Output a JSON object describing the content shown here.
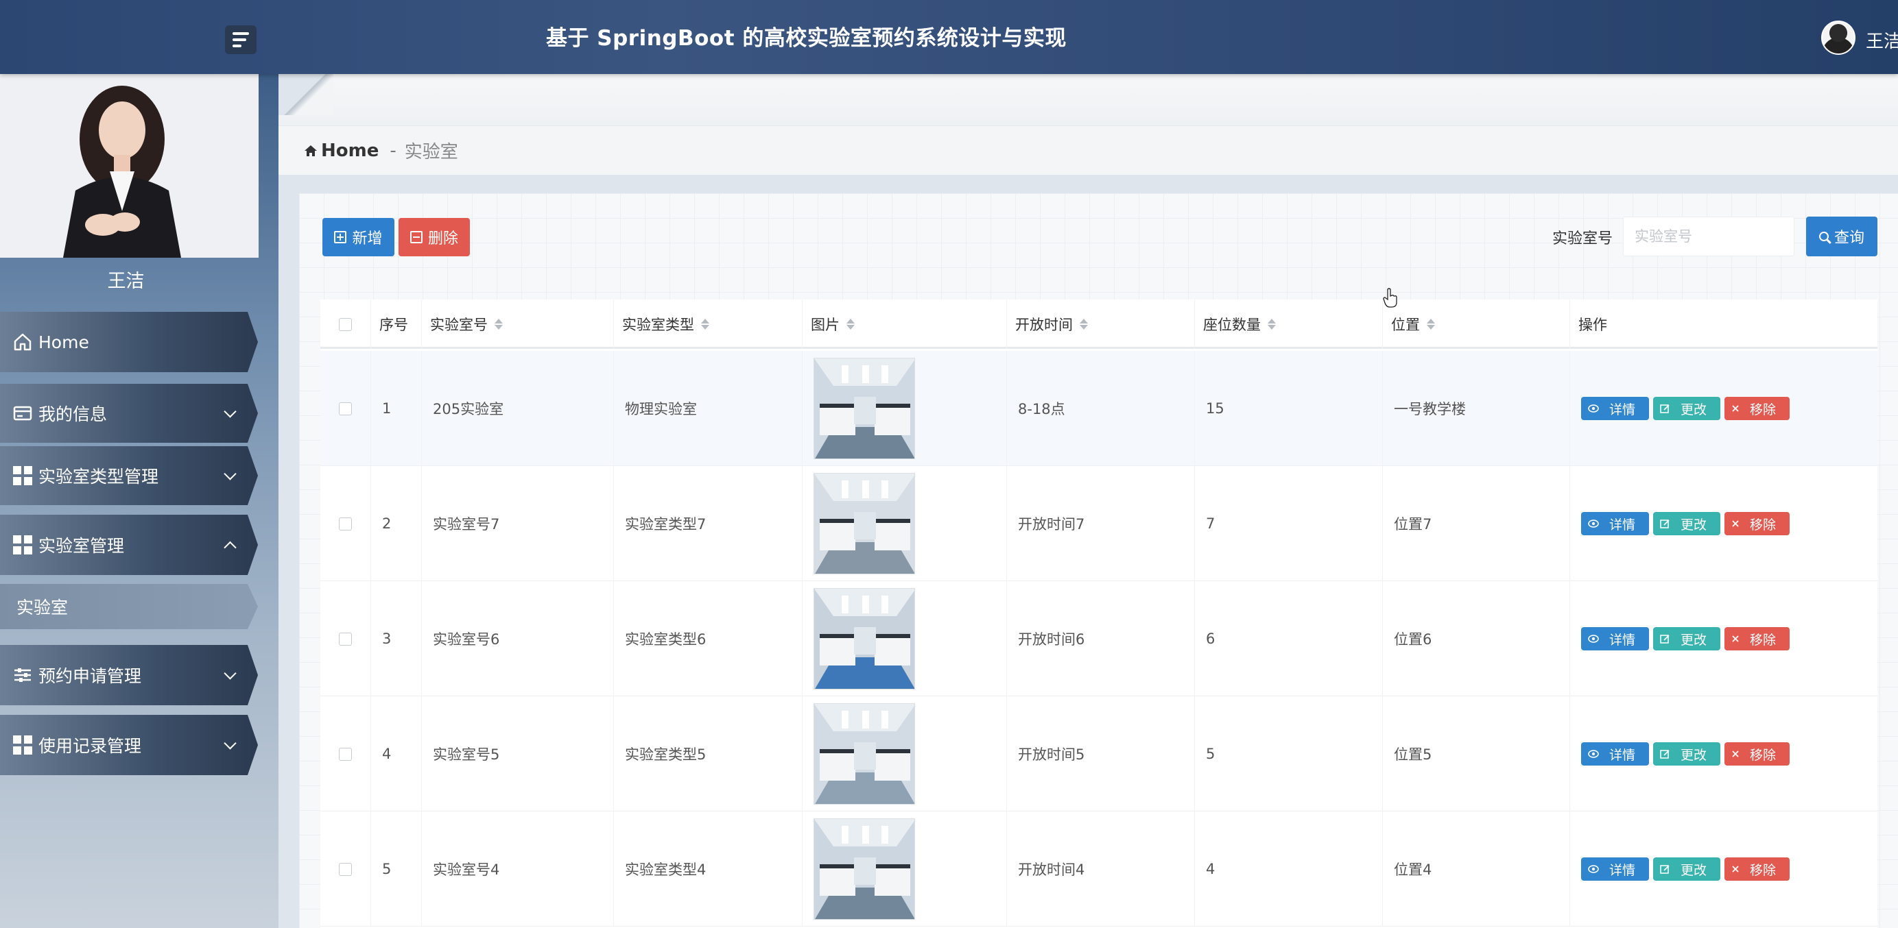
{
  "header": {
    "title": "基于 SpringBoot 的高校实验室预约系统设计与实现",
    "user_name": "王洁"
  },
  "sidebar": {
    "profile_name": "王洁",
    "items": [
      {
        "label": "Home",
        "icon": "home-icon"
      },
      {
        "label": "我的信息",
        "icon": "card-icon"
      },
      {
        "label": "实验室类型管理",
        "icon": "grid-icon"
      },
      {
        "label": "实验室管理",
        "icon": "grid-icon"
      },
      {
        "label": "实验室",
        "icon": ""
      },
      {
        "label": "预约申请管理",
        "icon": "sliders-icon"
      },
      {
        "label": "使用记录管理",
        "icon": "grid-icon"
      }
    ]
  },
  "breadcrumb": {
    "home": "Home",
    "separator": "-",
    "current": "实验室"
  },
  "toolbar": {
    "add_label": "新增",
    "delete_label": "删除",
    "search_label": "实验室号",
    "search_placeholder": "实验室号",
    "search_value": "",
    "search_button": "查询"
  },
  "table": {
    "headers": [
      "序号",
      "实验室号",
      "实验室类型",
      "图片",
      "开放时间",
      "座位数量",
      "位置",
      "操作"
    ],
    "actions": {
      "detail": "详情",
      "edit": "更改",
      "remove": "移除"
    },
    "rows": [
      {
        "index": "1",
        "room": "205实验室",
        "type": "物理实验室",
        "open": "8-18点",
        "seats": "15",
        "location": "一号教学楼"
      },
      {
        "index": "2",
        "room": "实验室号7",
        "type": "实验室类型7",
        "open": "开放时间7",
        "seats": "7",
        "location": "位置7"
      },
      {
        "index": "3",
        "room": "实验室号6",
        "type": "实验室类型6",
        "open": "开放时间6",
        "seats": "6",
        "location": "位置6"
      },
      {
        "index": "4",
        "room": "实验室号5",
        "type": "实验室类型5",
        "open": "开放时间5",
        "seats": "5",
        "location": "位置5"
      },
      {
        "index": "5",
        "room": "实验室号4",
        "type": "实验室类型4",
        "open": "开放时间4",
        "seats": "4",
        "location": "位置4"
      }
    ]
  },
  "colors": {
    "primary": "#2f7fcf",
    "danger": "#e2594f",
    "success": "#39b3ad",
    "header_bg": "#2b4772"
  }
}
